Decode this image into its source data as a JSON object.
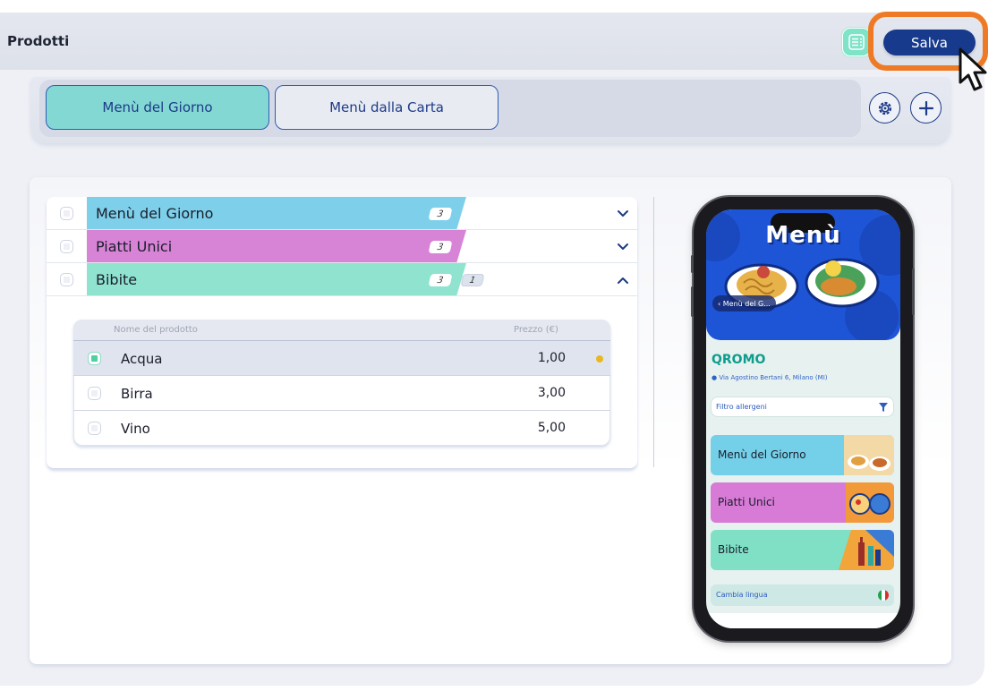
{
  "header": {
    "title": "Prodotti",
    "save_label": "Salva"
  },
  "menu_tabs": [
    {
      "label": "Menù del Giorno",
      "active": true
    },
    {
      "label": "Menù dalla Carta",
      "active": false
    }
  ],
  "categories": [
    {
      "name": "Menù del Giorno",
      "count": "3",
      "color": "#7ed0ea",
      "expanded": false
    },
    {
      "name": "Piatti Unici",
      "count": "3",
      "color": "#d884d6",
      "expanded": false
    },
    {
      "name": "Bibite",
      "count": "3",
      "extra_count": "1",
      "color": "#8fe3cf",
      "expanded": true
    }
  ],
  "products_table": {
    "columns": [
      "Nome del prodotto",
      "Prezzo (€)"
    ],
    "rows": [
      {
        "name": "Acqua",
        "price": "1,00",
        "selected": true
      },
      {
        "name": "Birra",
        "price": "3,00",
        "selected": false
      },
      {
        "name": "Vino",
        "price": "5,00",
        "selected": false
      }
    ]
  },
  "preview": {
    "hero_title": "Menù",
    "back_label": "‹ Menù del G...",
    "brand": "QROMO",
    "address": "Via Agostino Bertani 6, Milano (MI)",
    "filter_label": "Filtro allergeni",
    "menu_items": [
      {
        "label": "Menù del Giorno",
        "color": "#74d0e8"
      },
      {
        "label": "Piatti Unici",
        "color": "#d77bd6"
      },
      {
        "label": "Bibite",
        "color": "#7fe0c6"
      }
    ],
    "language_label": "Cambia lingua"
  },
  "colors": {
    "accent": "#173a8c",
    "highlight": "#ef7a26",
    "teal": "#83d8d4"
  }
}
